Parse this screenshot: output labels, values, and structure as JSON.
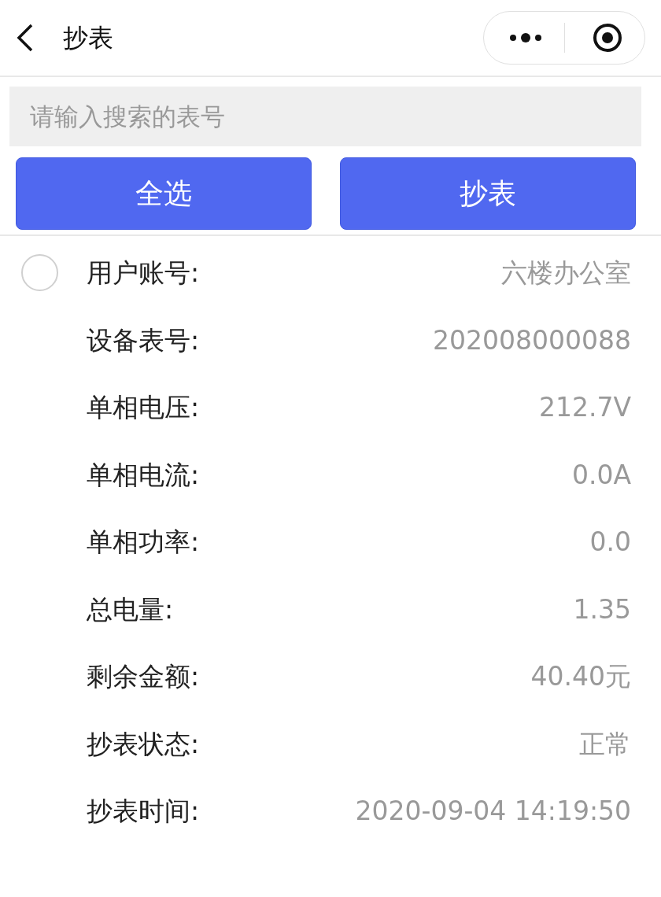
{
  "nav": {
    "title": "抄表"
  },
  "search": {
    "placeholder": "请输入搜索的表号"
  },
  "buttons": [
    "全选",
    "抄表"
  ],
  "record": {
    "selected": false,
    "fields": [
      {
        "label": "用户账号:",
        "value": "六楼办公室"
      },
      {
        "label": "设备表号:",
        "value": "202008000088"
      },
      {
        "label": "单相电压:",
        "value": "212.7V"
      },
      {
        "label": "单相电流:",
        "value": "0.0A"
      },
      {
        "label": "单相功率:",
        "value": "0.0"
      },
      {
        "label": "总电量:",
        "value": "1.35"
      },
      {
        "label": "剩余金额:",
        "value": "40.40元"
      },
      {
        "label": "抄表状态:",
        "value": "正常"
      },
      {
        "label": "抄表时间:",
        "value": "2020-09-04 14:19:50"
      }
    ]
  }
}
